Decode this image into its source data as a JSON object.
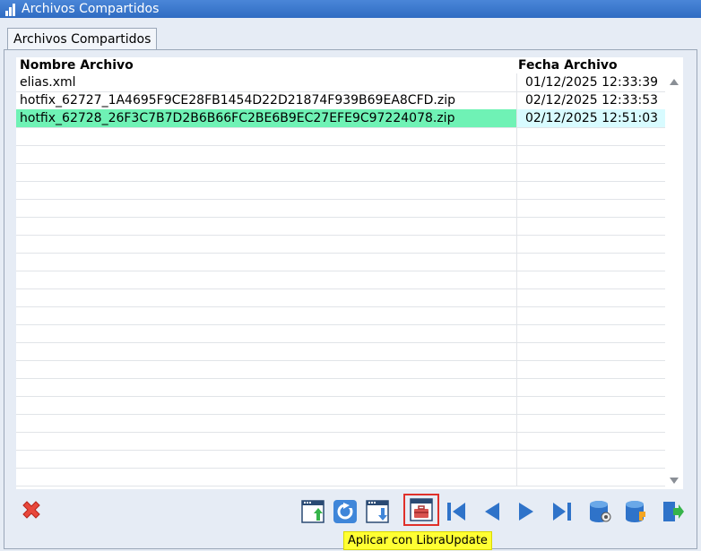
{
  "window": {
    "title": "Archivos Compartidos"
  },
  "tab": {
    "label": "Archivos Compartidos"
  },
  "grid": {
    "headers": {
      "name": "Nombre Archivo",
      "date": "Fecha Archivo"
    },
    "rows": [
      {
        "name": "elias.xml",
        "date": "01/12/2025 12:33:39"
      },
      {
        "name": "hotfix_62727_1A4695F9CE28FB1454D22D21874F939B69EA8CFD.zip",
        "date": "02/12/2025 12:33:53"
      },
      {
        "name": "hotfix_62728_26F3C7B7D2B6B66FC2BE6B9EC27EFE9C97224078.zip",
        "date": "02/12/2025 12:51:03"
      }
    ],
    "selected_index": 2
  },
  "toolbar": {
    "tooltip": "Aplicar con LibraUpdate"
  },
  "colors": {
    "selection": "#6ff2b5",
    "tooltip": "#ffff33",
    "accent_blue": "#2f6cc2"
  }
}
